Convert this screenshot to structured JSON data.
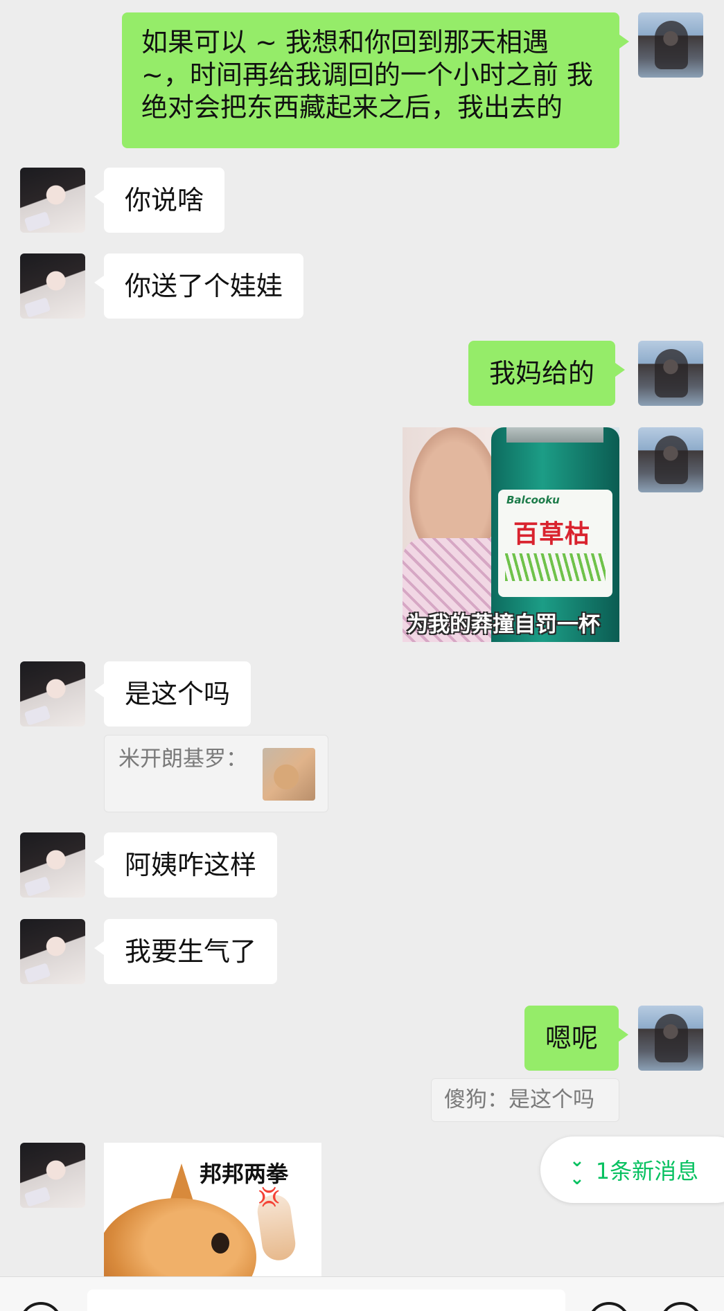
{
  "messages": [
    {
      "from": "me",
      "text": "如果可以 ~ 我想和你回到那天相遇 ~，时间再给我调回的一个小时之前 我绝对会把东西藏起来之后，我出去的"
    },
    {
      "from": "other",
      "text": "你说啥"
    },
    {
      "from": "other",
      "text": "你送了个娃娃"
    },
    {
      "from": "me",
      "text": "我妈给的"
    },
    {
      "from": "me",
      "type": "image",
      "label_brand": "Balcooku",
      "label_title": "百草枯",
      "caption": "为我的莽撞自罚一杯"
    },
    {
      "from": "other",
      "text": "是这个吗",
      "quote": "米开朗基罗："
    },
    {
      "from": "other",
      "text": "阿姨咋这样"
    },
    {
      "from": "other",
      "text": "我要生气了"
    },
    {
      "from": "me",
      "text": "嗯呢",
      "quote": "傻狗：是这个吗"
    },
    {
      "from": "other",
      "type": "image",
      "caption": "邦邦两拳",
      "mark": "💢"
    }
  ],
  "new_messages": {
    "icon": "chevron-double-down-icon",
    "label": "1条新消息"
  },
  "colors": {
    "self_bubble": "#95ec69",
    "other_bubble": "#ffffff",
    "background": "#ededed",
    "accent": "#07c160"
  }
}
